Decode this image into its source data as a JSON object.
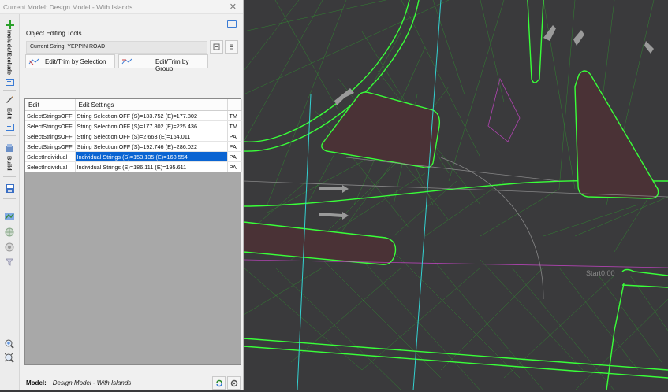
{
  "window": {
    "title": "Current Model: Design Model - With Islands"
  },
  "toolbar": {
    "tabs": [
      {
        "label": "Include/Exclude"
      },
      {
        "label": "Edit"
      },
      {
        "label": "Build"
      }
    ]
  },
  "object_editing": {
    "section_title": "Object Editing Tools",
    "current_string": "Current String: YEPPIN ROAD",
    "edit_by_selection_label": "Edit/Trim by Selection",
    "edit_by_group_label": "Edit/Trim by Group"
  },
  "table": {
    "columns": [
      "Edit",
      "Edit Settings",
      ""
    ],
    "rows": [
      {
        "edit": "SelectStringsOFF",
        "settings": "String Selection OFF (S)=133.752  (E)=177.802",
        "code": "TM",
        "selected": false
      },
      {
        "edit": "SelectStringsOFF",
        "settings": "String Selection OFF (S)=177.802  (E)=225.436",
        "code": "TM",
        "selected": false
      },
      {
        "edit": "SelectStringsOFF",
        "settings": "String Selection OFF (S)=2.663  (E)=164.011",
        "code": "PA",
        "selected": false
      },
      {
        "edit": "SelectStringsOFF",
        "settings": "String Selection OFF (S)=192.746  (E)=286.022",
        "code": "PA",
        "selected": false
      },
      {
        "edit": "SelectIndividual",
        "settings": "Individual Strings (S)=153.135  (E)=168.554",
        "code": "PA",
        "selected": true
      },
      {
        "edit": "SelectIndividual",
        "settings": "Individual Strings (S)=186.111  (E)=195.611",
        "code": "PA",
        "selected": false
      }
    ]
  },
  "footer": {
    "model_label": "Model:",
    "model_value": "Design Model - With Islands"
  },
  "cad": {
    "chainage_label": "Start0.00"
  },
  "colors": {
    "accent": "#0a64d2",
    "cad_background": "#3a3a3c",
    "triangle_lines": "#2f9c2f",
    "kerb_lines": "#39ff39",
    "alignment": "#33d1d1"
  },
  "icons": [
    "plus-icon",
    "panel-icon",
    "pencil-icon",
    "build-icon",
    "save-icon",
    "map-icon",
    "zoom-icon"
  ]
}
